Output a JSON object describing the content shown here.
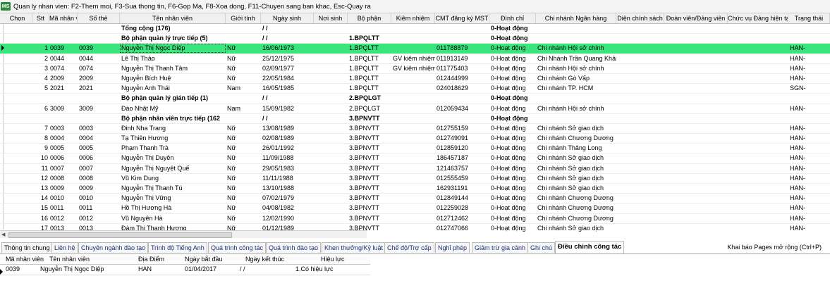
{
  "window": {
    "icon": "MS",
    "title": "Quan ly nhan vien: F2-Them moi, F3-Sua thong tin, F6-Gop Ma, F8-Xoa dong, F11-Chuyen sang ban khac, Esc-Quay ra"
  },
  "columns": [
    "Chọn",
    "Stt",
    "Mã nhân v",
    "Số thẻ",
    "Tên nhân viên",
    "Giới tính",
    "Ngày sinh",
    "Nơi sinh",
    "Bộ phận",
    "Kiêm nhiệm",
    "CMT đăng ký MST",
    "Đình chỉ",
    "Chi nhánh Ngân hàng",
    "Diện chính sách",
    "Đoàn viên/Đảng viên",
    "Chức vụ Đảng hiện tại",
    "Trạng thái"
  ],
  "rows": [
    {
      "kind": "group",
      "name": "Tổng cộng (176)",
      "dob": "/  /",
      "dept": "",
      "status": "0-Hoạt động"
    },
    {
      "kind": "group",
      "name": "Bộ phận quản lý trực tiếp (5)",
      "dob": "/  /",
      "dept": "1.BPQLTT",
      "status": "0-Hoạt động"
    },
    {
      "kind": "data",
      "selected": true,
      "stt": "1",
      "code": "0039",
      "card": "0039",
      "name": "Nguyễn Thị Ngọc Diệp",
      "gender": "Nữ",
      "dob": "16/06/1973",
      "dept": "1.BPQLTT",
      "concurrent": "",
      "cmt": "011788879",
      "status": "0-Hoạt động",
      "bank": "Chi nhánh Hội sở chính",
      "state": "HAN-"
    },
    {
      "kind": "data",
      "stt": "2",
      "code": "0044",
      "card": "0044",
      "name": "Lê Thị Thảo",
      "gender": "Nữ",
      "dob": "25/12/1975",
      "dept": "1.BPQLTT",
      "concurrent": "GV kiêm nhiệm",
      "cmt": "011913149",
      "status": "0-Hoạt động",
      "bank": "Chi Nhánh Trần Quang Khải",
      "state": "HAN-"
    },
    {
      "kind": "data",
      "stt": "3",
      "code": "0074",
      "card": "0074",
      "name": "Nguyễn Thị Thanh Tâm",
      "gender": "Nữ",
      "dob": "02/09/1977",
      "dept": "1.BPQLTT",
      "concurrent": "GV kiêm nhiệm",
      "cmt": "011775403",
      "status": "0-Hoạt động",
      "bank": "Chi nhánh Hội sở chính",
      "state": "HAN-"
    },
    {
      "kind": "data",
      "stt": "4",
      "code": "2009",
      "card": "2009",
      "name": "Nguyễn Bích Huệ",
      "gender": "Nữ",
      "dob": "22/05/1984",
      "dept": "1.BPQLTT",
      "concurrent": "",
      "cmt": "012444999",
      "status": "0-Hoạt động",
      "bank": "Chi nhánh Gò Vấp",
      "state": "HAN-"
    },
    {
      "kind": "data",
      "stt": "5",
      "code": "2021",
      "card": "2021",
      "name": "Nguyễn Anh Thái",
      "gender": "Nam",
      "dob": "16/05/1985",
      "dept": "1.BPQLTT",
      "concurrent": "",
      "cmt": "024018629",
      "status": "0-Hoạt động",
      "bank": "Chi nhánh TP. HCM",
      "state": "SGN-"
    },
    {
      "kind": "group",
      "name": "Bộ phận quản lý gián tiếp (1)",
      "dob": "/  /",
      "dept": "2.BPQLGT",
      "status": "0-Hoạt động"
    },
    {
      "kind": "data",
      "stt": "6",
      "code": "3009",
      "card": "3009",
      "name": "Đào Nhật Mỹ",
      "gender": "Nam",
      "dob": "15/09/1982",
      "dept": "2.BPQLGT",
      "concurrent": "",
      "cmt": "012059434",
      "status": "0-Hoạt động",
      "bank": "Chi nhánh Hội sở chính",
      "state": "HAN-"
    },
    {
      "kind": "group",
      "name": "Bộ phận nhân viên trực tiếp (162",
      "dob": "/  /",
      "dept": "3.BPNVTT",
      "status": "0-Hoạt động"
    },
    {
      "kind": "data",
      "stt": "7",
      "code": "0003",
      "card": "0003",
      "name": "Đinh Nha Trang",
      "gender": "Nữ",
      "dob": "13/08/1989",
      "dept": "3.BPNVTT",
      "concurrent": "",
      "cmt": "012755159",
      "status": "0-Hoạt động",
      "bank": "Chi nhánh Sở giao dịch",
      "state": "HAN-"
    },
    {
      "kind": "data",
      "stt": "8",
      "code": "0004",
      "card": "0004",
      "name": "Tạ Thiên Hương",
      "gender": "Nữ",
      "dob": "02/08/1989",
      "dept": "3.BPNVTT",
      "concurrent": "",
      "cmt": "012749091",
      "status": "0-Hoạt động",
      "bank": "Chi nhánh Chương Dương",
      "state": "HAN-"
    },
    {
      "kind": "data",
      "stt": "9",
      "code": "0005",
      "card": "0005",
      "name": "Phạm Thanh Trà",
      "gender": "Nữ",
      "dob": "26/01/1992",
      "dept": "3.BPNVTT",
      "concurrent": "",
      "cmt": "012859120",
      "status": "0-Hoạt động",
      "bank": "Chi nhánh Thăng Long",
      "state": "HAN-"
    },
    {
      "kind": "data",
      "stt": "10",
      "code": "0006",
      "card": "0006",
      "name": "Nguyễn Thị Duyên",
      "gender": "Nữ",
      "dob": "11/09/1988",
      "dept": "3.BPNVTT",
      "concurrent": "",
      "cmt": "186457187",
      "status": "0-Hoạt động",
      "bank": "Chi nhánh Sở giao dịch",
      "state": "HAN-"
    },
    {
      "kind": "data",
      "stt": "11",
      "code": "0007",
      "card": "0007",
      "name": "Nguyễn Thị Nguyệt Quế",
      "gender": "Nữ",
      "dob": "29/05/1983",
      "dept": "3.BPNVTT",
      "concurrent": "",
      "cmt": "121463757",
      "status": "0-Hoạt động",
      "bank": "Chi nhánh Sở giao dịch",
      "state": "HAN-"
    },
    {
      "kind": "data",
      "stt": "12",
      "code": "0008",
      "card": "0008",
      "name": "Vũ Kim Dung",
      "gender": "Nữ",
      "dob": "11/11/1988",
      "dept": "3.BPNVTT",
      "concurrent": "",
      "cmt": "012555459",
      "status": "0-Hoạt động",
      "bank": "Chi nhánh Sở giao dịch",
      "state": "HAN-"
    },
    {
      "kind": "data",
      "stt": "13",
      "code": "0009",
      "card": "0009",
      "name": "Nguyễn Thị Thanh Tú",
      "gender": "Nữ",
      "dob": "13/10/1988",
      "dept": "3.BPNVTT",
      "concurrent": "",
      "cmt": "162931191",
      "status": "0-Hoạt động",
      "bank": "Chi nhánh Sở giao dịch",
      "state": "HAN-"
    },
    {
      "kind": "data",
      "stt": "14",
      "code": "0010",
      "card": "0010",
      "name": "Nguyễn Thị Vững",
      "gender": "Nữ",
      "dob": "07/02/1979",
      "dept": "3.BPNVTT",
      "concurrent": "",
      "cmt": "012849144",
      "status": "0-Hoạt động",
      "bank": "Chi nhánh Chương Dương",
      "state": "HAN-"
    },
    {
      "kind": "data",
      "stt": "15",
      "code": "0011",
      "card": "0011",
      "name": "Hồ Thị Hương Hà",
      "gender": "Nữ",
      "dob": "04/08/1982",
      "dept": "3.BPNVTT",
      "concurrent": "",
      "cmt": "012259028",
      "status": "0-Hoạt động",
      "bank": "Chi nhánh Chương Dương",
      "state": "HAN-"
    },
    {
      "kind": "data",
      "stt": "16",
      "code": "0012",
      "card": "0012",
      "name": "Vũ Nguyên Hà",
      "gender": "Nữ",
      "dob": "12/02/1990",
      "dept": "3.BPNVTT",
      "concurrent": "",
      "cmt": "012712462",
      "status": "0-Hoạt động",
      "bank": "Chi nhánh Chương Dương",
      "state": "HAN-"
    },
    {
      "kind": "data",
      "stt": "17",
      "code": "0013",
      "card": "0013",
      "name": "Đàm Thị Thanh Hương",
      "gender": "Nữ",
      "dob": "01/12/1989",
      "dept": "3.BPNVTT",
      "concurrent": "",
      "cmt": "012747066",
      "status": "0-Hoạt động",
      "bank": "Chi nhánh Sở giao dịch",
      "state": "HAN-"
    }
  ],
  "tabs": [
    "Thông tin chung",
    "Liên hệ",
    "Chuyên ngành đào tạo",
    "Trình độ Tiếng Anh",
    "Quá trình công tác",
    "Quá trình đào tạo",
    "Khen thưởng/Kỷ luật",
    "Chế độ/Trợ cấp",
    "Nghỉ phép",
    "Giảm trừ gia cảnh",
    "Ghi chú",
    "Điều chỉnh công tác"
  ],
  "active_tab": "Điều chỉnh công tác",
  "extra_link": "Khai báo Pages mở rộng (Ctrl+P)",
  "sub_columns": [
    "Mã nhân viên",
    "Tên nhân viên",
    "Địa Điểm",
    "Ngày bắt đầu",
    "Ngày kết thúc",
    "Hiệu lực"
  ],
  "sub_rows": [
    {
      "code": "0039",
      "name": "Nguyễn Thị Ngọc Diệp",
      "location": "HAN",
      "start": "01/04/2017",
      "end": "/  /",
      "effect": "1.Có hiệu lực"
    }
  ]
}
